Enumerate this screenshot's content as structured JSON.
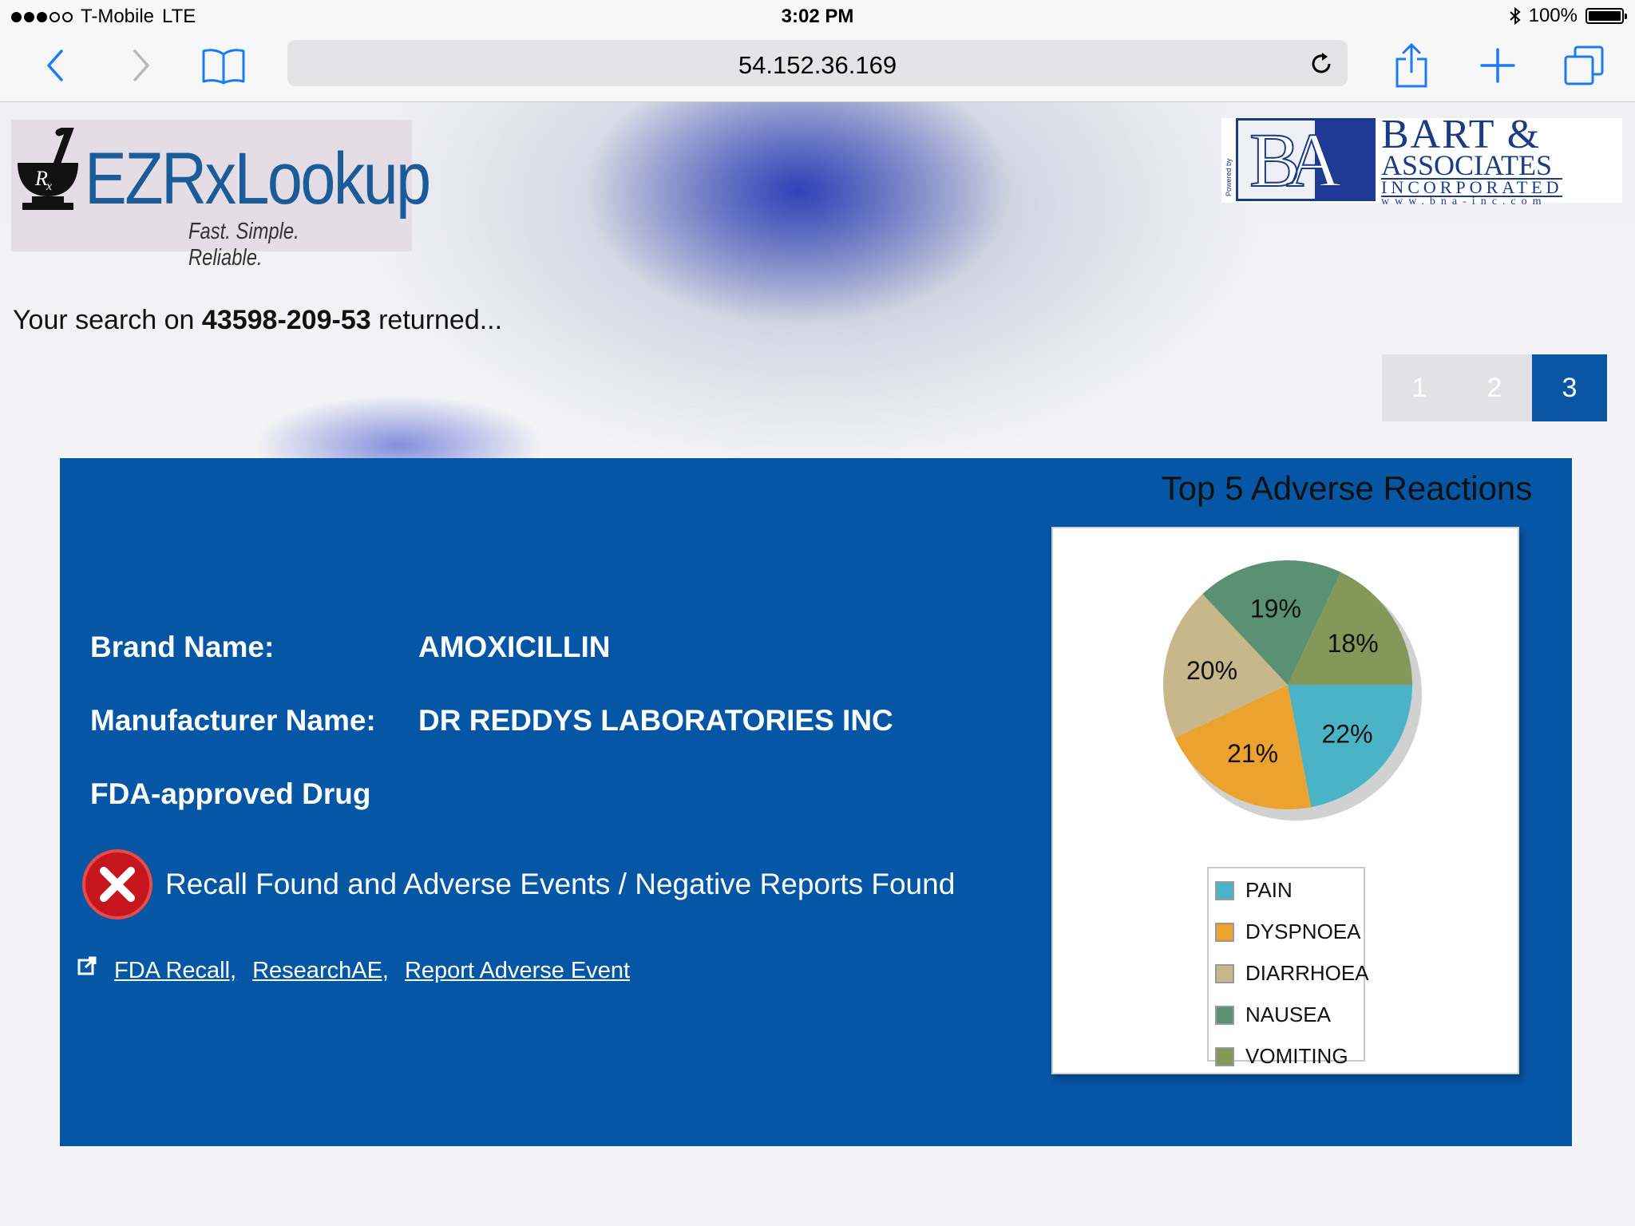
{
  "status_bar": {
    "carrier": "T-Mobile",
    "network": "LTE",
    "time": "3:02 PM",
    "battery": "100%",
    "signal_bars": 3,
    "signal_total": 5
  },
  "browser": {
    "url": "54.152.36.169",
    "icons": [
      "back-icon",
      "forward-icon",
      "bookmarks-icon",
      "reload-icon",
      "share-icon",
      "new-tab-icon",
      "tabs-icon"
    ]
  },
  "header": {
    "logo_brand": "EZRxLookup",
    "logo_tagline": "Fast. Simple. Reliable.",
    "partner_monogram": "BA",
    "partner_line1": "BART &",
    "partner_line2": "ASSOCIATES",
    "partner_line3": "INCORPORATED",
    "partner_line4": "www.bna-inc.com",
    "partner_powered": "Powered by"
  },
  "search": {
    "prefix": "Your search on ",
    "query": "43598-209-53",
    "suffix": " returned..."
  },
  "pagination": {
    "pages": [
      "1",
      "2",
      "3"
    ],
    "active": "3"
  },
  "drug": {
    "brand_label": "Brand Name:",
    "brand_value": "AMOXICILLIN",
    "manufacturer_label": "Manufacturer Name:",
    "manufacturer_value": "DR REDDYS LABORATORIES INC",
    "approval": "FDA-approved Drug",
    "status_text": "Recall Found and Adverse Events / Negative Reports Found",
    "links": [
      "FDA Recall,",
      "ResearchAE,",
      "Report Adverse Event"
    ]
  },
  "chart_data": {
    "type": "pie",
    "title": "Top 5 Adverse Reactions",
    "categories": [
      "PAIN",
      "DYSPNOEA",
      "DIARRHOEA",
      "NAUSEA",
      "VOMITING"
    ],
    "values": [
      22,
      21,
      20,
      19,
      18
    ],
    "labels": [
      "22%",
      "21%",
      "20%",
      "19%",
      "18%"
    ],
    "colors": [
      "#4bb3c6",
      "#eba22e",
      "#c8b78a",
      "#5a9172",
      "#84985a"
    ],
    "legend_position": "bottom"
  },
  "colors": {
    "panel": "#0556a5",
    "active_page": "#0a55a4",
    "alert": "#c4161c"
  }
}
